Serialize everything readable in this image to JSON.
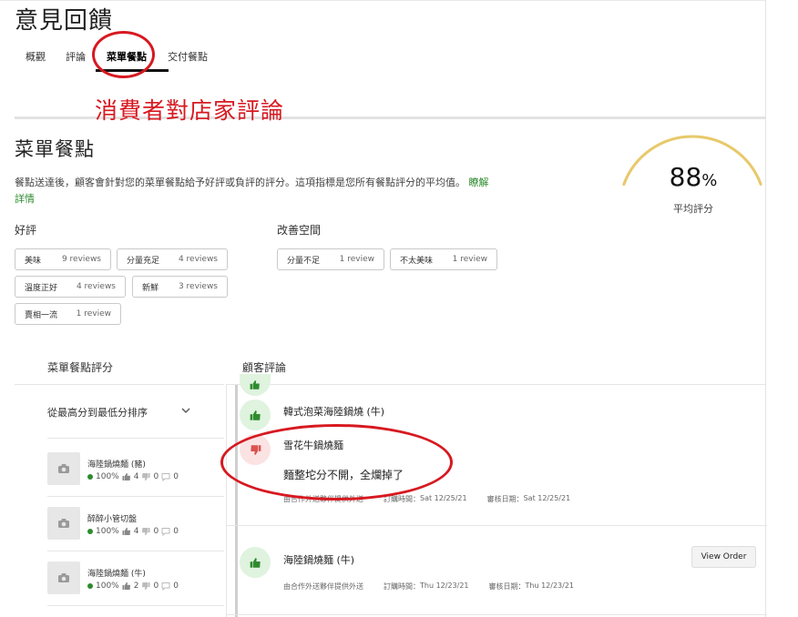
{
  "page": {
    "title": "意見回饋"
  },
  "tabs": [
    {
      "label": "概觀"
    },
    {
      "label": "評論"
    },
    {
      "label": "菜單餐點"
    },
    {
      "label": "交付餐點"
    }
  ],
  "annotation": {
    "caption": "消費者對店家評論"
  },
  "section": {
    "title": "菜單餐點",
    "description": "餐點送達後，顧客會針對您的菜單餐點給予好評或負評的評分。這項指標是您所有餐點評分的平均值。",
    "learn_more_1": "瞭解",
    "learn_more_2": "詳情"
  },
  "gauge": {
    "value": "88",
    "unit": "%",
    "label": "平均評分",
    "fraction": 0.88,
    "accent": "#e8c96a"
  },
  "positive": {
    "heading": "好評",
    "chips": [
      {
        "label": "美味",
        "count": "9 reviews"
      },
      {
        "label": "分量充足",
        "count": "4 reviews"
      },
      {
        "label": "溫度正好",
        "count": "4 reviews"
      },
      {
        "label": "新鮮",
        "count": "3 reviews"
      },
      {
        "label": "賣相一流",
        "count": "1 review"
      }
    ]
  },
  "negative": {
    "heading": "改善空間",
    "chips": [
      {
        "label": "分量不足",
        "count": "1 review"
      },
      {
        "label": "不太美味",
        "count": "1 review"
      }
    ]
  },
  "items_panel": {
    "heading": "菜單餐點評分",
    "sort_label": "從最高分到最低分排序",
    "items": [
      {
        "name": "海陸鍋燒麵 (豬)",
        "percent": "100%",
        "up": "4",
        "down": "0",
        "comments": "0"
      },
      {
        "name": "醉醉小管切盤",
        "percent": "100%",
        "up": "4",
        "down": "0",
        "comments": "0"
      },
      {
        "name": "海陸鍋燒麵 (牛)",
        "percent": "100%",
        "up": "2",
        "down": "0",
        "comments": "0"
      }
    ]
  },
  "reviews_panel": {
    "heading": "顧客評論",
    "reviews": [
      {
        "dish": "韓式泡菜海陸鍋燒 (牛)",
        "sentiment": "positive"
      },
      {
        "dish": "雪花牛鍋燒麵",
        "sentiment": "negative",
        "comment": "麵整坨分不開，全爛掉了",
        "delivery": "由合作外送夥伴提供外送",
        "order_label": "訂購時間：",
        "order_time": "Sat 12/25/21",
        "review_label": "審核日期：",
        "review_time": "Sat 12/25/21"
      },
      {
        "dish": "海陸鍋燒麵 (牛)",
        "sentiment": "positive",
        "delivery": "由合作外送夥伴提供外送",
        "order_label": "訂購時間：",
        "order_time": "Thu 12/23/21",
        "review_label": "審核日期：",
        "review_time": "Thu 12/23/21",
        "button": "View Order"
      }
    ]
  },
  "colors": {
    "brand_green": "#2e8b2e",
    "annotation_red": "#d71920",
    "thumb_down_red": "#d9534f"
  }
}
